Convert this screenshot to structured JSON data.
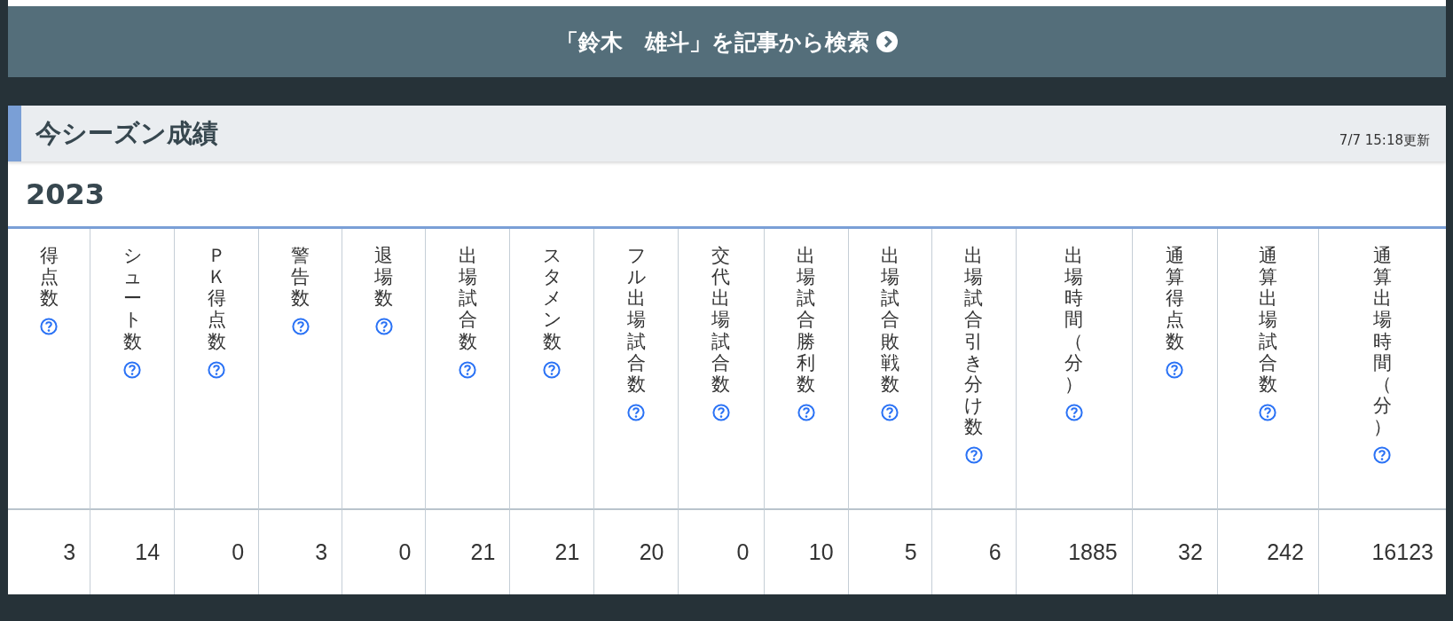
{
  "search_banner": {
    "label": "「鈴木　雄斗」を記事から検索"
  },
  "section": {
    "title": "今シーズン成績",
    "updated": "7/7 15:18更新",
    "season": "2023"
  },
  "table": {
    "columns": [
      "得点数",
      "シュート数",
      "ＰＫ得点数",
      "警告数",
      "退場数",
      "出場試合数",
      "スタメン数",
      "フル出場試合数",
      "交代出場試合数",
      "出場試合勝利数",
      "出場試合敗戦数",
      "出場試合引き分け数",
      "出場時間（分）",
      "通算得点数",
      "通算出場試合数",
      "通算出場時間（分）"
    ],
    "rows": [
      [
        "3",
        "14",
        "0",
        "3",
        "0",
        "21",
        "21",
        "20",
        "0",
        "10",
        "5",
        "6",
        "1885",
        "32",
        "242",
        "16123"
      ]
    ]
  }
}
